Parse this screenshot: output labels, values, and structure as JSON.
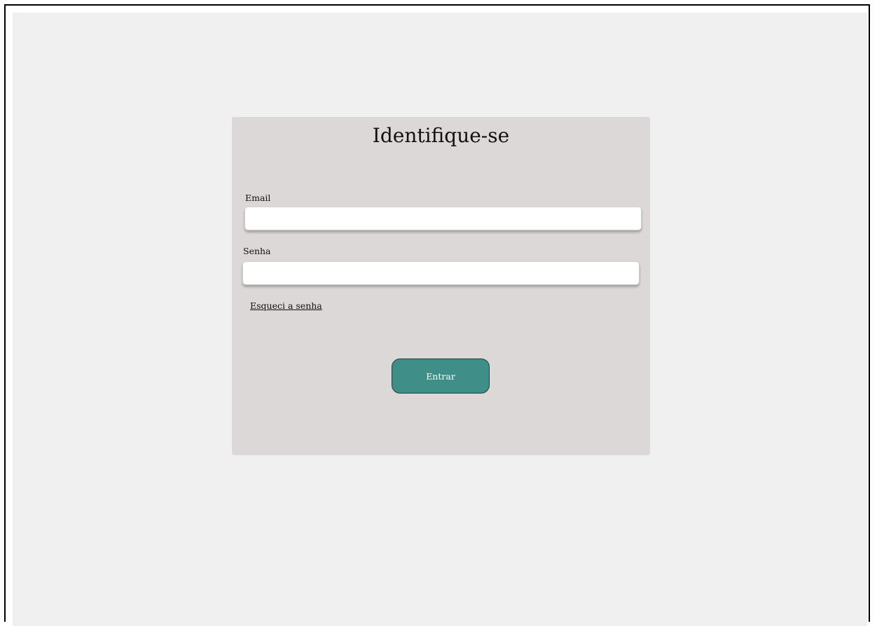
{
  "login": {
    "title": "Identifique-se",
    "email_label": "Email",
    "email_value": "",
    "password_label": "Senha",
    "password_value": "",
    "forgot_password": "Esqueci a senha",
    "submit_label": "Entrar"
  },
  "colors": {
    "page_background": "#f0f0f0",
    "card_background": "#dcd8d7",
    "button_background": "#3f8f88",
    "button_border": "#1f3f3c"
  }
}
